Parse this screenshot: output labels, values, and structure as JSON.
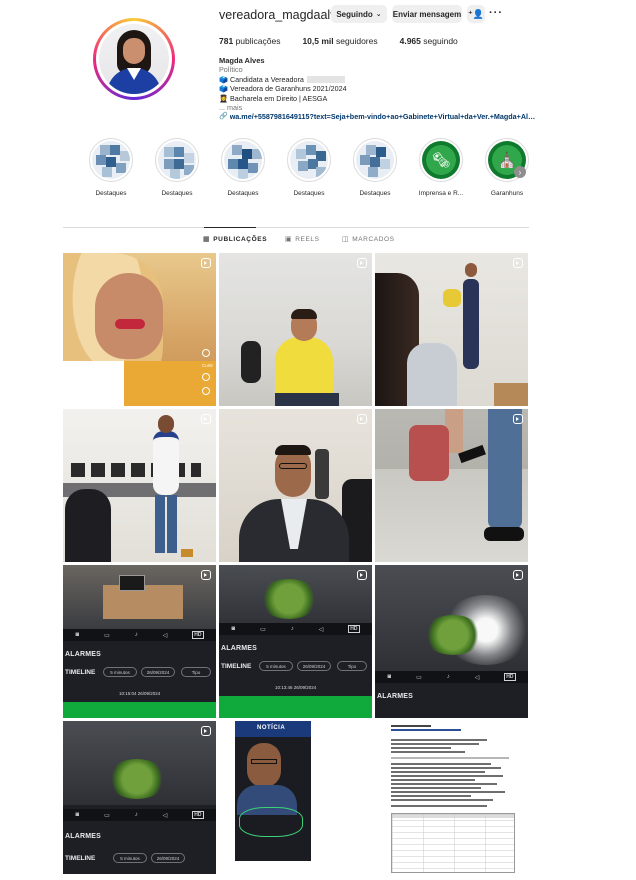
{
  "profile": {
    "username": "vereadora_magdaalves",
    "following_button": "Seguindo",
    "message_button": "Enviar mensagem",
    "stats": {
      "posts_count": "781",
      "posts_label": "publicações",
      "followers_count": "10,5 mil",
      "followers_label": "seguidores",
      "following_count": "4.965",
      "following_label": "seguindo"
    },
    "bio": {
      "name": "Magda Alves",
      "category": "Político",
      "line1": "🗳️ Candidata a Vereadora",
      "line2": "🗳️ Vereadora de Garanhuns 2021/2024",
      "line3": "👩‍🎓 Bacharela em Direito | AESGA",
      "more": "... mais",
      "link": "wa.me/+5587981649115?text=Seja+bem-vindo+ao+Gabinete+Virtual+da+Ver.+Magda+Alve..."
    }
  },
  "highlights": [
    {
      "label": "Destaques",
      "kind": "pixelated"
    },
    {
      "label": "Destaques",
      "kind": "pixelated"
    },
    {
      "label": "Destaques",
      "kind": "pixelated"
    },
    {
      "label": "Destaques",
      "kind": "pixelated"
    },
    {
      "label": "Destaques",
      "kind": "pixelated"
    },
    {
      "label": "Imprensa e R...",
      "kind": "green-icon",
      "icon": "press-icon"
    },
    {
      "label": "Garanhuns",
      "kind": "green-icon",
      "icon": "city-icon"
    }
  ],
  "tabs": {
    "posts": "PUBLICAÇÕES",
    "reels": "REELS",
    "tagged": "MARCADOS",
    "active": "posts"
  },
  "posts": {
    "p1_side_label": "Curtir",
    "camera": {
      "alarms": "ALARMES",
      "timeline": "TIMELINE",
      "range": "5 minutos",
      "date": "26/09/2024",
      "type": "Tipo",
      "stamp_p7": "10:15:04  26/09/2024",
      "stamp_p8": "10:13:46  26/09/2024",
      "hd": "HD"
    },
    "p11_banner": "NOTÍCIA",
    "colors": {
      "accent_green": "#0fa93c",
      "link_blue": "#00376b"
    }
  }
}
